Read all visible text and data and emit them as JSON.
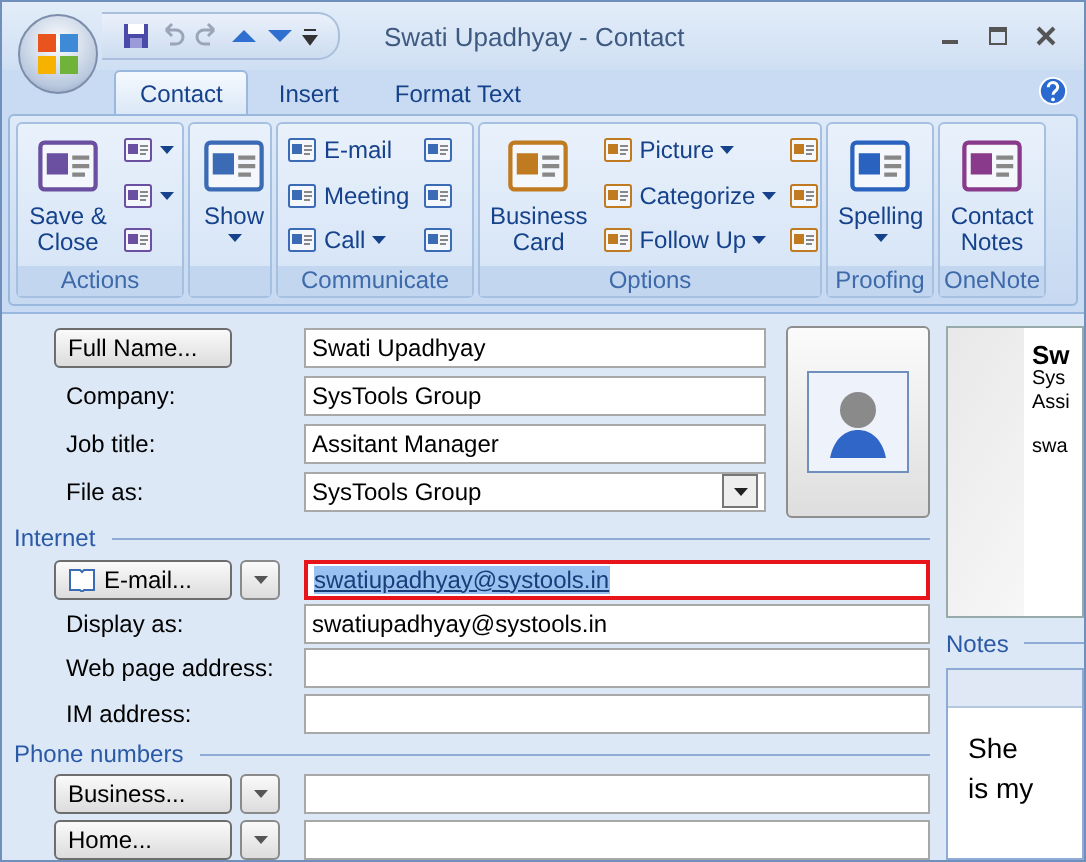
{
  "window": {
    "title": "Swati Upadhyay - Contact"
  },
  "tabs": [
    {
      "label": "Contact",
      "selected": true
    },
    {
      "label": "Insert",
      "selected": false
    },
    {
      "label": "Format Text",
      "selected": false
    }
  ],
  "ribbon": [
    {
      "label": "Actions",
      "items": [
        {
          "kind": "large",
          "label": "Save & Close",
          "dropdown": false
        },
        {
          "kind": "icon",
          "dropdown": true
        },
        {
          "kind": "icon",
          "dropdown": true
        },
        {
          "kind": "icon",
          "dropdown": false
        }
      ]
    },
    {
      "items": [
        {
          "kind": "large",
          "label": "Show",
          "dropdown": true
        }
      ]
    },
    {
      "label": "Communicate",
      "items": [
        {
          "kind": "small",
          "label": "E-mail",
          "dropdown": false
        },
        {
          "kind": "small",
          "label": "Meeting",
          "dropdown": false
        },
        {
          "kind": "small",
          "label": "Call",
          "dropdown": true
        },
        {
          "kind": "icon",
          "dropdown": false
        },
        {
          "kind": "icon",
          "dropdown": false
        },
        {
          "kind": "icon",
          "dropdown": false
        }
      ]
    },
    {
      "label": "Options",
      "items": [
        {
          "kind": "large",
          "label": "Business Card",
          "dropdown": false
        },
        {
          "kind": "small",
          "label": "Picture",
          "dropdown": true
        },
        {
          "kind": "small",
          "label": "Categorize",
          "dropdown": true
        },
        {
          "kind": "small",
          "label": "Follow Up",
          "dropdown": true
        },
        {
          "kind": "icon",
          "dropdown": false
        },
        {
          "kind": "icon",
          "dropdown": false
        },
        {
          "kind": "icon",
          "dropdown": false
        }
      ]
    },
    {
      "label": "Proofing",
      "items": [
        {
          "kind": "large",
          "label": "Spelling",
          "dropdown": true
        }
      ]
    },
    {
      "label": "OneNote",
      "items": [
        {
          "kind": "large",
          "label": "Contact Notes",
          "dropdown": false
        }
      ]
    }
  ],
  "form": [
    {
      "kind": "button",
      "label": "Full Name...",
      "dropdown": false,
      "value": "Swati Upadhyay",
      "focused": false
    },
    {
      "kind": "text",
      "label": "Company:",
      "value": "SysTools Group",
      "focused": false
    },
    {
      "kind": "text",
      "label": "Job title:",
      "value": "Assitant Manager",
      "focused": false
    },
    {
      "kind": "combo",
      "label": "File as:",
      "value": "SysTools Group",
      "focused": false
    },
    {
      "kind": "section",
      "label": "Internet"
    },
    {
      "kind": "button",
      "label": "E-mail...",
      "dropdown": true,
      "value": "swatiupadhyay@systools.in",
      "focused": true
    },
    {
      "kind": "text",
      "label": "Display as:",
      "value": "swatiupadhyay@systools.in",
      "focused": false
    },
    {
      "kind": "text",
      "label": "Web page address:",
      "focused": false
    },
    {
      "kind": "text",
      "label": "IM address:",
      "focused": false
    },
    {
      "kind": "section",
      "label": "Phone numbers"
    },
    {
      "kind": "button",
      "label": "Business...",
      "dropdown": true,
      "focused": false
    },
    {
      "kind": "button",
      "label": "Home...",
      "dropdown": true,
      "focused": false
    }
  ],
  "business_card": {
    "lines": [
      "Sw",
      "Sys",
      "Assi",
      "swa"
    ]
  },
  "notes": {
    "label": "Notes",
    "text": "She is my"
  }
}
